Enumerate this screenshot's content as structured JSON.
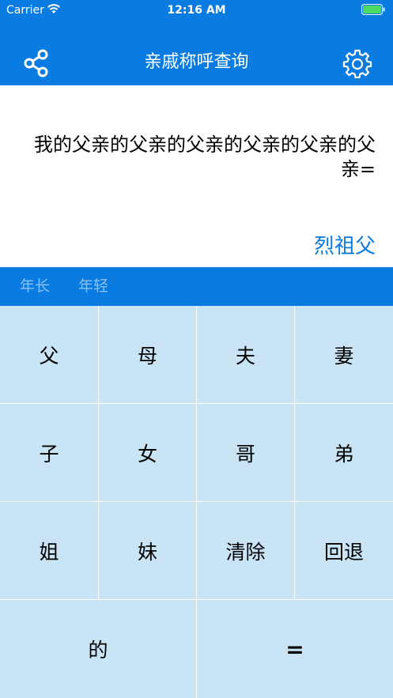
{
  "status_bar": {
    "carrier": "Carrier",
    "time": "12:16 AM"
  },
  "nav": {
    "title": "亲戚称呼查询",
    "share_icon": "share-icon",
    "settings_icon": "gear-icon"
  },
  "display": {
    "expression": "我的父亲的父亲的父亲的父亲的父亲的父亲=",
    "result": "烈祖父"
  },
  "mode": {
    "elder_label": "年长",
    "younger_label": "年轻"
  },
  "keypad": {
    "row1": [
      "父",
      "母",
      "夫",
      "妻"
    ],
    "row2": [
      "子",
      "女",
      "哥",
      "弟"
    ],
    "row3": [
      "姐",
      "妹",
      "清除",
      "回退"
    ],
    "row4": [
      "的",
      "="
    ]
  },
  "colors": {
    "primary": "#0a7be0",
    "keypad_bg": "#c8e4f5",
    "mode_inactive": "#8ec0ee"
  }
}
